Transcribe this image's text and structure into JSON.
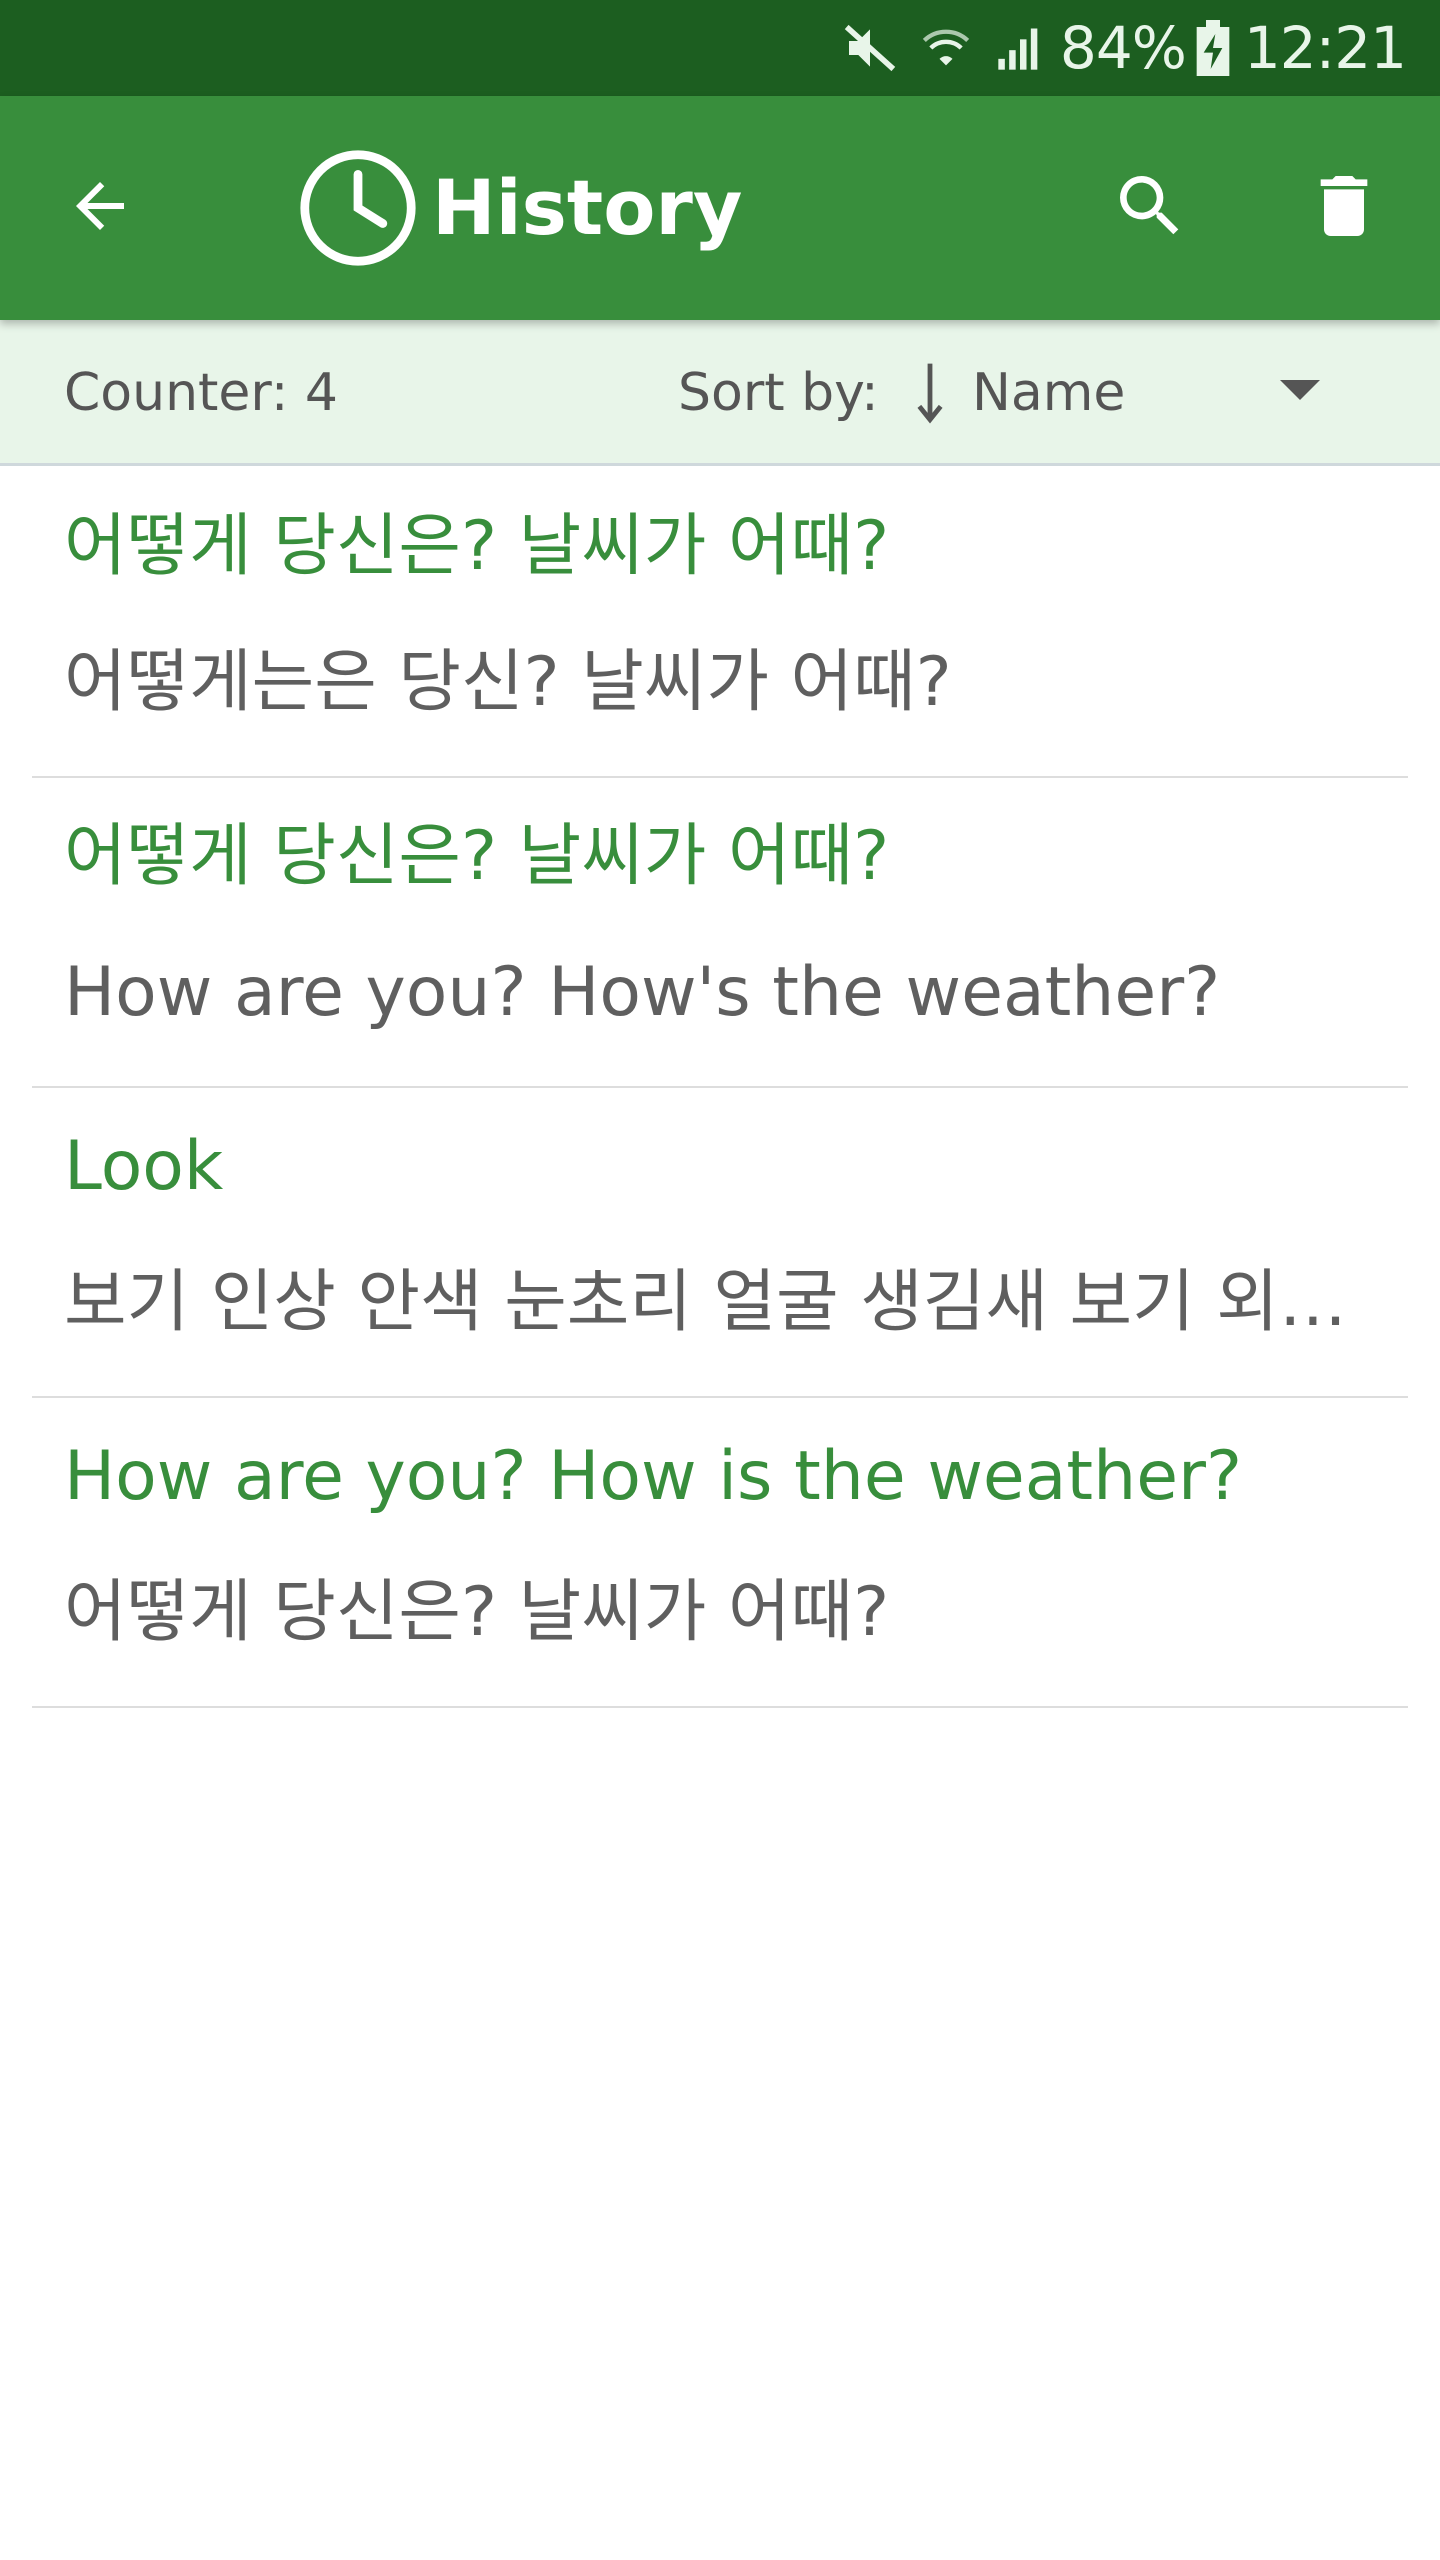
{
  "status_bar": {
    "battery": "84%",
    "time": "12:21",
    "icons": [
      "mute-icon",
      "wifi-icon",
      "signal-icon",
      "battery-charging-icon"
    ]
  },
  "app_bar": {
    "title": "History",
    "icons": {
      "back": "arrow-left-icon",
      "title_icon": "clock-icon",
      "search": "search-icon",
      "delete": "trash-icon"
    }
  },
  "toolbar": {
    "counter": "Counter: 4",
    "sort_label": "Sort by:",
    "sort_value": "Name"
  },
  "history": [
    {
      "source": "어떻게 당신은? 날씨가 어때?",
      "target": "어떻게는은 당신? 날씨가 어때?"
    },
    {
      "source": "어떻게 당신은? 날씨가 어때?",
      "target": "How are you? How's the weather?"
    },
    {
      "source": "Look",
      "target": "보기  인상 안색 눈초리 얼굴 생김새 보기 외관 모양"
    },
    {
      "source": "How are you? How is the weather?",
      "target": "어떻게 당신은? 날씨가 어때?"
    }
  ],
  "colors": {
    "status_bar": "#1c5e20",
    "app_bar": "#388e3c",
    "toolbar_bg": "#e8f5e9",
    "source_text": "#388e3c",
    "target_text": "#5f5f5f"
  }
}
